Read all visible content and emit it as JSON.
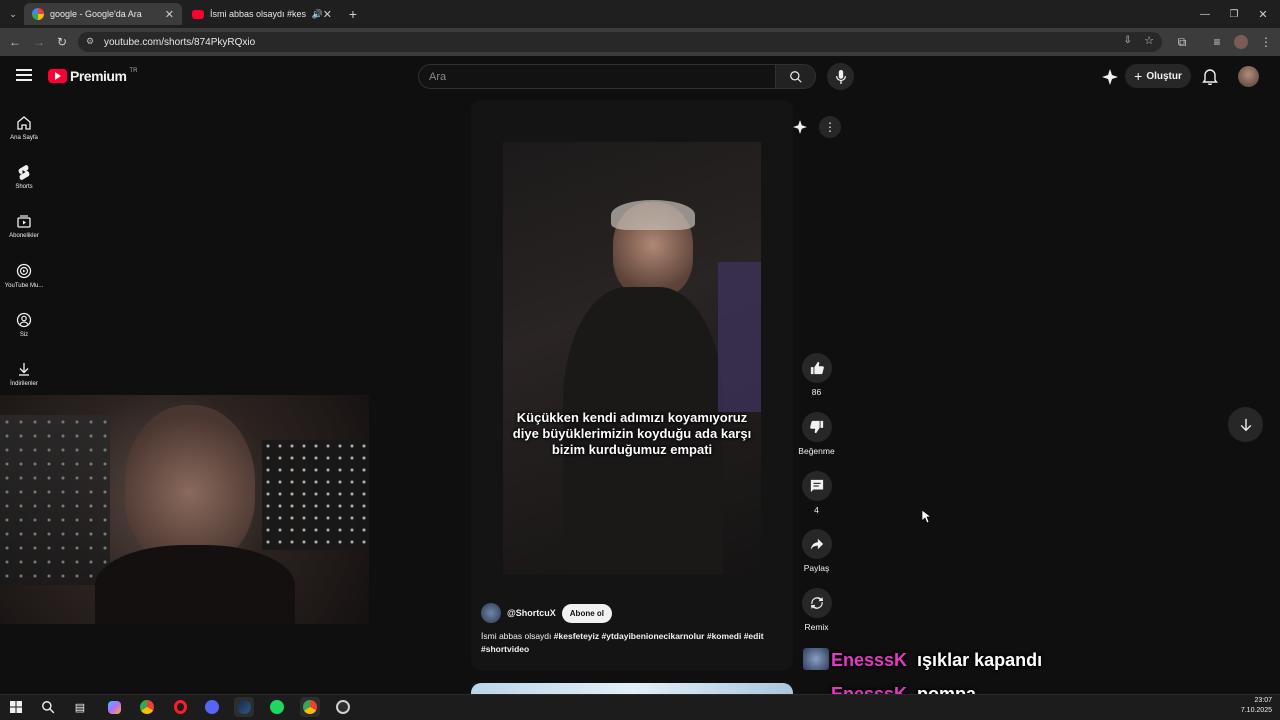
{
  "browser": {
    "tabs": [
      {
        "title": "google - Google'da Ara",
        "active": true
      },
      {
        "title": "İsmi abbas olsaydı #kesfete",
        "active": false
      }
    ],
    "url": "youtube.com/shorts/874PkyRQxio"
  },
  "youtube": {
    "logo_text": "Premium",
    "region": "TR",
    "search_placeholder": "Ara",
    "create_label": "Oluştur",
    "sidebar": [
      {
        "label": "Ana Sayfa",
        "icon": "home-icon"
      },
      {
        "label": "Shorts",
        "icon": "shorts-icon"
      },
      {
        "label": "Abonelikler",
        "icon": "subscriptions-icon"
      },
      {
        "label": "YouTube Mu...",
        "icon": "youtube-music-icon"
      },
      {
        "label": "Siz",
        "icon": "profile-icon"
      },
      {
        "label": "İndirilenler",
        "icon": "download-icon"
      }
    ]
  },
  "short": {
    "caption": "Küçükken kendi adımızı koyamıyoruz diye büyüklerimizin koyduğu ada karşı bizim kurduğumuz empati",
    "channel": "@ShortcuX",
    "subscribe_label": "Abone ol",
    "description_plain": "İsmi abbas olsaydı",
    "description_tags": "#kesfeteyiz #ytdayibenionecikarnolur #komedi #edit #shortvideo",
    "actions": {
      "like_count": "86",
      "dislike_label": "Beğenme",
      "comment_count": "4",
      "share_label": "Paylaş",
      "remix_label": "Remix"
    }
  },
  "chat": [
    {
      "user": "EnesssK",
      "message": "ışıklar kapandı"
    },
    {
      "user": "EnesssK",
      "message": "pompa"
    }
  ],
  "taskbar": {
    "time": "23:07",
    "date": "7.10.2025"
  },
  "colors": {
    "accent_red": "#ff0033",
    "chat_user": "#e23ac3",
    "background": "#0f0f0f"
  }
}
